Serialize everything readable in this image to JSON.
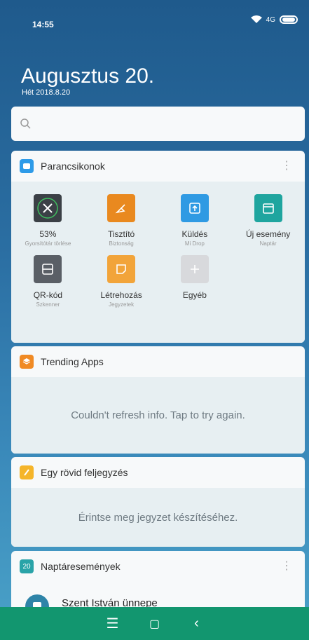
{
  "status": {
    "time": "14:55",
    "signal": "4G"
  },
  "header": {
    "date": "Augusztus 20.",
    "subdate": "Hét 2018.8.20"
  },
  "search": {
    "placeholder": ""
  },
  "shortcuts": {
    "title": "Parancsikonok",
    "items": [
      {
        "label": "53%",
        "sub": "Gyorsítótár törlése",
        "icon": "close-icon",
        "color": "#3b4046"
      },
      {
        "label": "Tisztító",
        "sub": "Biztonság",
        "icon": "broom-icon",
        "color": "#e9891f"
      },
      {
        "label": "Küldés",
        "sub": "Mi Drop",
        "icon": "upload-icon",
        "color": "#2f9ae3"
      },
      {
        "label": "Új esemény",
        "sub": "Naptár",
        "icon": "calendar-icon",
        "color": "#1fa59f"
      },
      {
        "label": "QR-kód",
        "sub": "Szkenner",
        "icon": "scanner-icon",
        "color": "#5a5f66"
      },
      {
        "label": "Létrehozás",
        "sub": "Jegyzetek",
        "icon": "note-icon",
        "color": "#f2a43a"
      },
      {
        "label": "Egyéb",
        "sub": "",
        "icon": "plus-icon",
        "color": "#d8d9dc"
      }
    ]
  },
  "trending": {
    "title": "Trending Apps",
    "message": "Couldn't refresh info. Tap to try again."
  },
  "note": {
    "title": "Egy rövid feljegyzés",
    "message": "Érintse meg jegyzet készítéséhez."
  },
  "calendar": {
    "title": "Naptáresemények",
    "day": "20",
    "event": "Szent István ünnepe"
  },
  "navbar": {
    "menu": "☰",
    "home": "▢",
    "back": "‹"
  },
  "colors": {
    "background_top": "#1f5a8c",
    "background_bottom": "#4aa2c8",
    "navbar": "#12966f",
    "trending_icon": "#f08a24",
    "note_icon": "#f5b52a",
    "calendar_icon": "#29a3a8",
    "shortcuts_icon": "#2e9be8"
  }
}
